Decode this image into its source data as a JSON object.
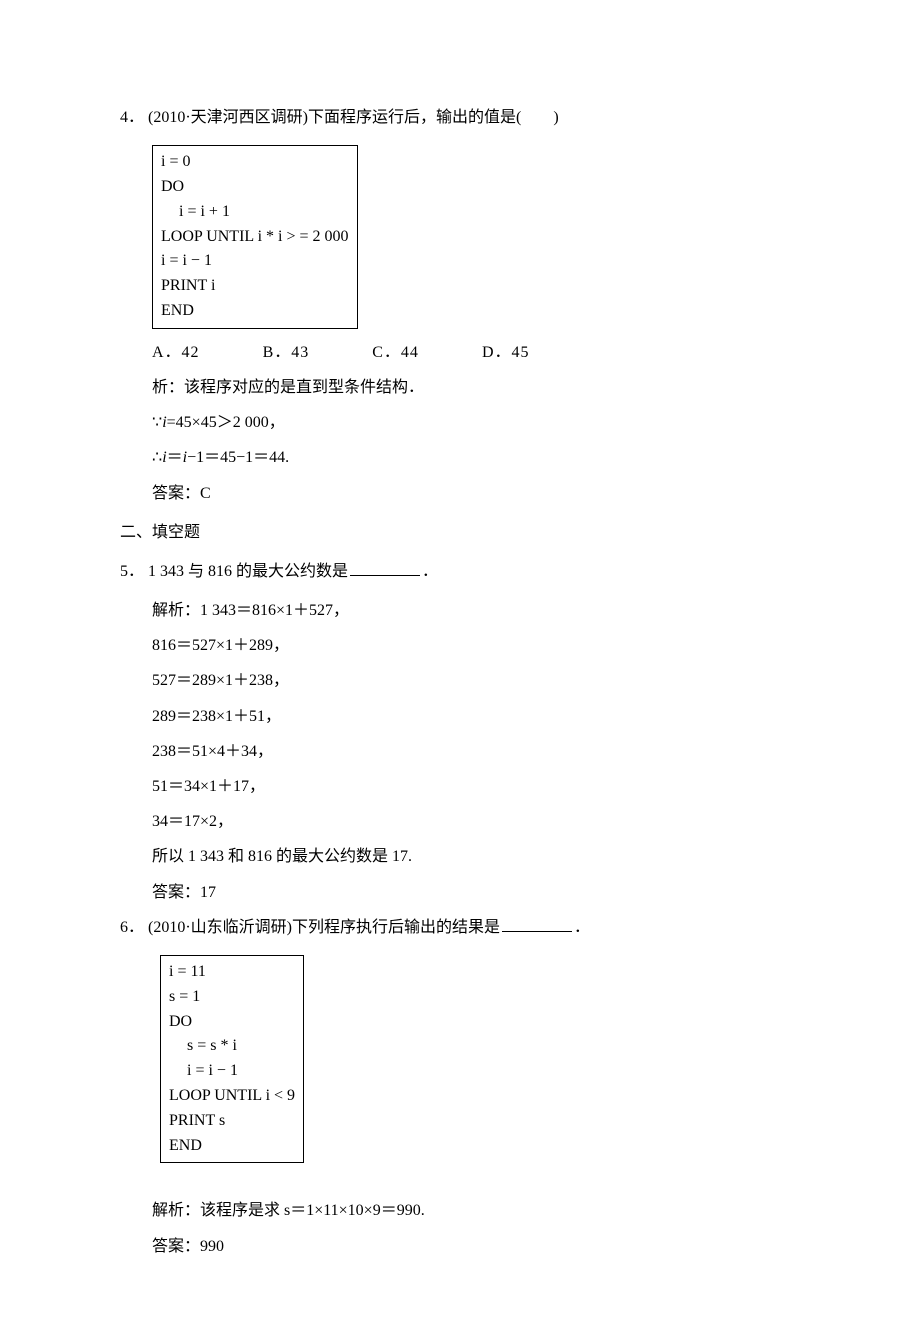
{
  "q4": {
    "number": "4．",
    "stem": "(2010·天津河西区调研)下面程序运行后，输出的值是(　　)",
    "code": [
      "i = 0",
      "DO",
      "  i = i + 1",
      "LOOP UNTIL i * i > = 2 000",
      "i = i − 1",
      "PRINT   i",
      "END"
    ],
    "opts": {
      "a": "A．42",
      "b": "B．43",
      "c": "C．44",
      "d": "D．45"
    },
    "ana1": "析：该程序对应的是直到型条件结构．",
    "ana2_pre": "∵",
    "ana2_iv": "i",
    "ana2_rest": "=45×45＞2 000，",
    "ana3_pre": "∴",
    "ana3_iv": "i",
    "ana3_mid": "＝",
    "ana3_iv2": "i",
    "ana3_rest": "−1＝45−1＝44.",
    "ans_label": "答案：",
    "ans": "C"
  },
  "section2": "二、填空题",
  "q5": {
    "number": "5．",
    "stem_pre": "1 343 与 816 的最大公约数是",
    "stem_post": "．",
    "s1": "解析：1 343＝816×1＋527，",
    "s2": "816＝527×1＋289，",
    "s3": "527＝289×1＋238，",
    "s4": "289＝238×1＋51，",
    "s5": "238＝51×4＋34，",
    "s6": "51＝34×1＋17，",
    "s7": "34＝17×2，",
    "s8": " 所以 1 343 和 816 的最大公约数是 17.",
    "ans_label": "答案：",
    "ans": "17"
  },
  "q6": {
    "number": "6．",
    "stem_pre": "(2010·山东临沂调研)下列程序执行后输出的结果是",
    "stem_post": "．",
    "code": [
      "i = 11",
      "s = 1",
      "DO",
      "  s = s * i",
      "  i = i − 1",
      "LOOP UNTIL   i < 9",
      "PRINT   s",
      "END"
    ],
    "ana": "解析：该程序是求 s＝1×11×10×9＝990.",
    "ans_label": "答案：",
    "ans": "990"
  }
}
